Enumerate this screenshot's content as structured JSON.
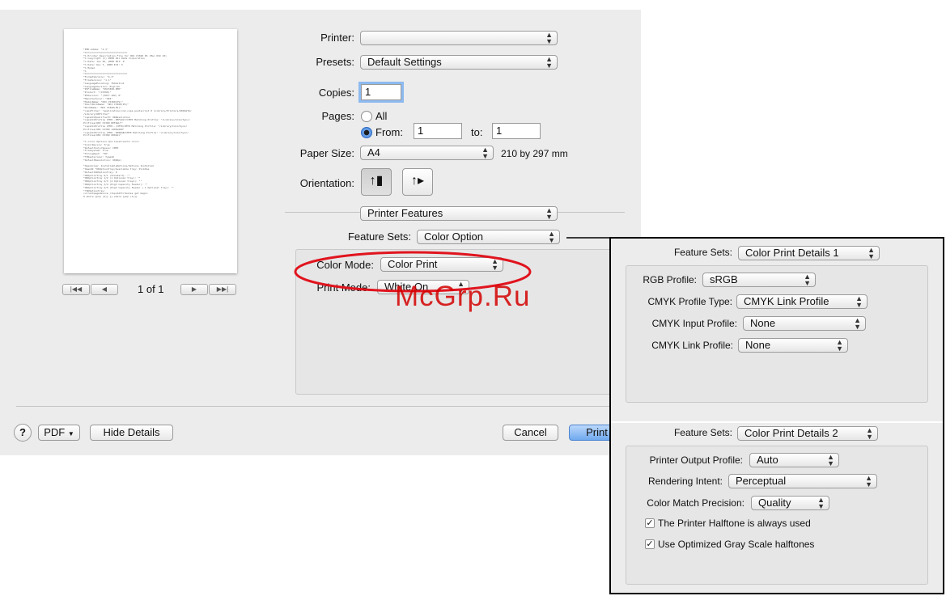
{
  "dialog": {
    "preview": {
      "page_indicator": "1 of 1",
      "lines": [
        "*PPD-Adobe: \"4.3\"",
        "*%============================",
        "*% Printer Description File for OKI C5360 PS (Mac OSX 10)",
        "*% Copyright (C) 2008 Oki Data Corporation",
        "*% Date: Jan 29, 2008 Edt: 0",
        "*% Date: Dec 3, 2008 Edt: 5",
        "*% Model",
        "*%",
        "*%============================",
        "*FormatVersion: \"4.3\"",
        "*FileVersion: \"1.1\"",
        "*LanguageEncoding: ISOLatin1",
        "*LanguageVersion: English",
        "*PCFileName: \"OKC5360.PPD\"",
        "*Product: \"(C5360)\"",
        "*PSVersion: \"(3017.102) 0\"",
        "*Manufacturer: \"OKI\"",
        "*ModelName: \"OKI C5360(PS)\"",
        "*ShortNickName: \"OKI C5360(PS)\"",
        "*NickName: \"OKI C5360(PS)\"",
        "*cupsFilter: \"application/vnd.cups-postscript 0 /Library/Printers/OKIDATA/",
        "/Library/OKFilter\"",
        "*cupsICCQualifier0: OKResolution",
        "*cupsICCProfile CMYK..DEFAULT/CMYK Matching Profile: \"/Library/ColorSync/",
        "Profiles/OKI C5360 DEFAULT\"",
        "*cupsICCProfile CMYK../CMYK/CMYK Matching Profile: \"/Library/ColorSync/",
        "Profiles/OKI C5360 1200x600\"",
        "*cupsICCProfile CMYK..600RGB/CMYK Matching Profile: \"/Library/ColorSync/",
        "Profiles/OKI C5360 600dpi\"",
        "",
        "*% ===== Options and Constraints =====",
        "*ColorDevice: True",
        "*DefaultColorSpace: CMYK",
        "*FileSystem: True",
        "*Throughput: \"30\"",
        "*TTRasterizer: Type42",
        "*DefaultResolution: 600dpi",
        "",
        "*OpenGroup: InstallableOptions/Options Installed",
        "*OpenUI *OKOptionTray/Available Tray: PickOne",
        "*DefaultOKOptionTray: 0",
        "*OKOptionTray 0/1 (Standard): \"\"",
        "*OKOptionTray 1/2 (1 Optional Tray): \"\"",
        "*OKOptionTray 2/3 (2 Optional Trays): \"\"",
        "*OKOptionTray 3/4 (High Capacity Feeder): \"\"",
        "*OKOptionTray 4/5 (High Capacity Feeder + 1 Optional Tray): \"\"",
        "*?OKOptionTray:",
        "  currentpagedevice /InputAttributes get begin",
        "  0 where {pop (4)} {} where {pop (3)}}"
      ]
    },
    "printer": {
      "label": "Printer:",
      "value": ""
    },
    "presets": {
      "label": "Presets:",
      "value": "Default Settings"
    },
    "copies": {
      "label": "Copies:",
      "value": "1"
    },
    "pages": {
      "label": "Pages:",
      "all": "All",
      "from": "From:",
      "from_value": "1",
      "to": "to:",
      "to_value": "1"
    },
    "paper_size": {
      "label": "Paper Size:",
      "value": "A4",
      "dimensions": "210 by 297 mm"
    },
    "orientation": {
      "label": "Orientation:"
    },
    "section_popup": "Printer Features",
    "feature_sets": {
      "label": "Feature Sets:",
      "value": "Color Option"
    },
    "color_mode": {
      "label": "Color Mode:",
      "value": "Color Print"
    },
    "print_mode": {
      "label": "Print Mode:",
      "value": "White On"
    },
    "footer": {
      "help": "?",
      "pdf": "PDF",
      "hide_details": "Hide Details",
      "cancel": "Cancel",
      "print": "Print"
    }
  },
  "panel1": {
    "feature_sets_label": "Feature Sets:",
    "feature_sets_value": "Color Print Details 1",
    "rgb_profile": {
      "label": "RGB Profile:",
      "value": "sRGB"
    },
    "cmyk_profile_type": {
      "label": "CMYK Profile Type:",
      "value": "CMYK Link Profile"
    },
    "cmyk_input_profile": {
      "label": "CMYK Input Profile:",
      "value": "None"
    },
    "cmyk_link_profile": {
      "label": "CMYK Link Profile:",
      "value": "None"
    }
  },
  "panel2": {
    "feature_sets_label": "Feature Sets:",
    "feature_sets_value": "Color Print Details 2",
    "printer_output_profile": {
      "label": "Printer Output Profile:",
      "value": "Auto"
    },
    "rendering_intent": {
      "label": "Rendering Intent:",
      "value": "Perceptual"
    },
    "color_match_precision": {
      "label": "Color Match Precision:",
      "value": "Quality"
    },
    "halftone_check": "The Printer Halftone is always used",
    "gray_scale_check": "Use Optimized Gray Scale halftones"
  },
  "watermark": "McGrp.Ru",
  "colors": {
    "highlight_ellipse": "#e0141e",
    "focus_ring": "#5d9ce6",
    "watermark": "#d40000"
  }
}
